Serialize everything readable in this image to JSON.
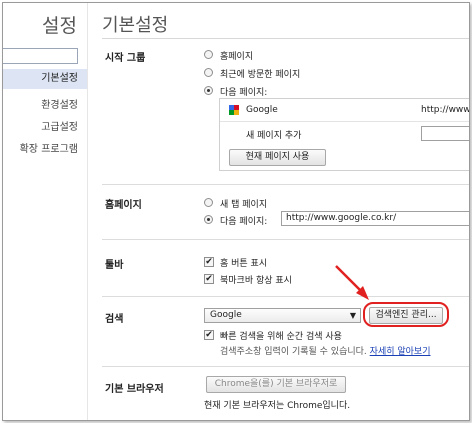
{
  "sidebar": {
    "title": "설정",
    "search_value": "",
    "items": [
      {
        "label": "기본설정",
        "active": true
      },
      {
        "label": "환경설정",
        "active": false
      },
      {
        "label": "고급설정",
        "active": false
      },
      {
        "label": "확장 프로그램",
        "active": false
      }
    ]
  },
  "page_title": "기본설정",
  "startup": {
    "label": "시작 그룹",
    "options": [
      "홈페이지",
      "최근에 방문한 페이지",
      "다음 페이지:"
    ],
    "selected_index": 2,
    "page_name": "Google",
    "page_url": "http://www.g",
    "add_page_label": "새 페이지 추가",
    "add_page_value": "",
    "use_current_button": "현재 페이지 사용"
  },
  "homepage": {
    "label": "홈페이지",
    "options": [
      "새 탭 페이지",
      "다음 페이지:"
    ],
    "selected_index": 1,
    "url": "http://www.google.co.kr/"
  },
  "toolbar": {
    "label": "툴바",
    "options": [
      "홈 버튼 표시",
      "북마크바 항상 표시"
    ]
  },
  "search": {
    "label": "검색",
    "engine": "Google",
    "manage_button": "검색엔진 관리...",
    "instant_label": "빠른 검색을 위해 순간 검색 사용",
    "instant_note": "검색주소창 입력이 기록될 수 있습니다.",
    "learn_more": "자세히 알아보기"
  },
  "default_browser": {
    "label": "기본 브라우저",
    "button": "Chrome을(를) 기본 브라우저로",
    "status": "현재 기본 브라우저는 Chrome입니다."
  },
  "colors": {
    "highlight": "#e12020",
    "link": "#1a3fb5",
    "active_nav": "#dde5f4"
  }
}
